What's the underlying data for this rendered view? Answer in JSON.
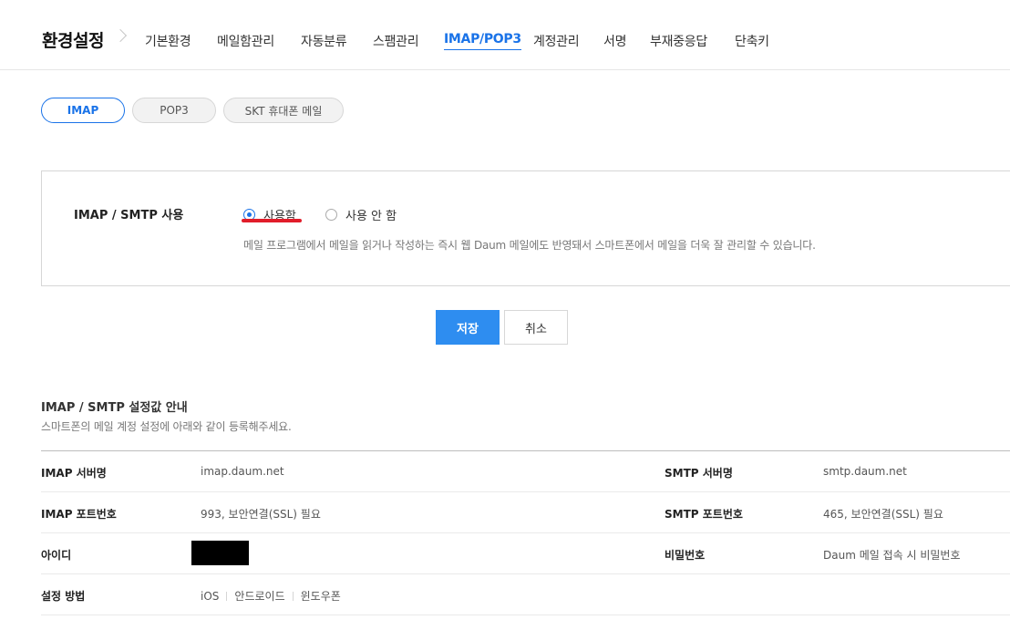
{
  "header": {
    "title": "환경설정",
    "nav": [
      {
        "label": "기본환경",
        "active": false
      },
      {
        "label": "메일함관리",
        "active": false
      },
      {
        "label": "자동분류",
        "active": false
      },
      {
        "label": "스팸관리",
        "active": false
      },
      {
        "label": "IMAP/POP3",
        "active": true
      },
      {
        "label": "계정관리",
        "active": false
      },
      {
        "label": "서명",
        "active": false
      },
      {
        "label": "부재중응답",
        "active": false
      },
      {
        "label": "단축키",
        "active": false
      }
    ]
  },
  "protocol_tabs": [
    {
      "label": "IMAP",
      "active": true
    },
    {
      "label": "POP3",
      "active": false
    },
    {
      "label": "SKT 휴대폰 메일",
      "active": false
    }
  ],
  "setting": {
    "label": "IMAP / SMTP 사용",
    "options": [
      {
        "label": "사용함",
        "selected": true
      },
      {
        "label": "사용 안 함",
        "selected": false
      }
    ],
    "description": "메일 프로그램에서 메일을 읽거나 작성하는 즉시 웹 Daum 메일에도 반영돼서 스마트폰에서 메일을 더욱 잘 관리할 수 있습니다."
  },
  "buttons": {
    "save": "저장",
    "cancel": "취소"
  },
  "info": {
    "title": "IMAP / SMTP 설정값 안내",
    "subtitle": "스마트폰의 메일 계정 설정에 아래와 같이 등록해주세요.",
    "rows": [
      {
        "k1": "IMAP 서버명",
        "v1": "imap.daum.net",
        "k2": "SMTP 서버명",
        "v2": "smtp.daum.net"
      },
      {
        "k1": "IMAP 포트번호",
        "v1": "993, 보안연결(SSL) 필요",
        "k2": "SMTP 포트번호",
        "v2": "465, 보안연결(SSL) 필요"
      },
      {
        "k1": "아이디",
        "v1": "",
        "k2": "비밀번호",
        "v2": "Daum 메일 접속 시 비밀번호"
      },
      {
        "k1": "설정 방법",
        "links": [
          "iOS",
          "안드로이드",
          "윈도우폰"
        ]
      }
    ]
  },
  "colors": {
    "accent": "#1a73e8",
    "save_button": "#2e8df0",
    "highlight": "#e11d2a"
  }
}
